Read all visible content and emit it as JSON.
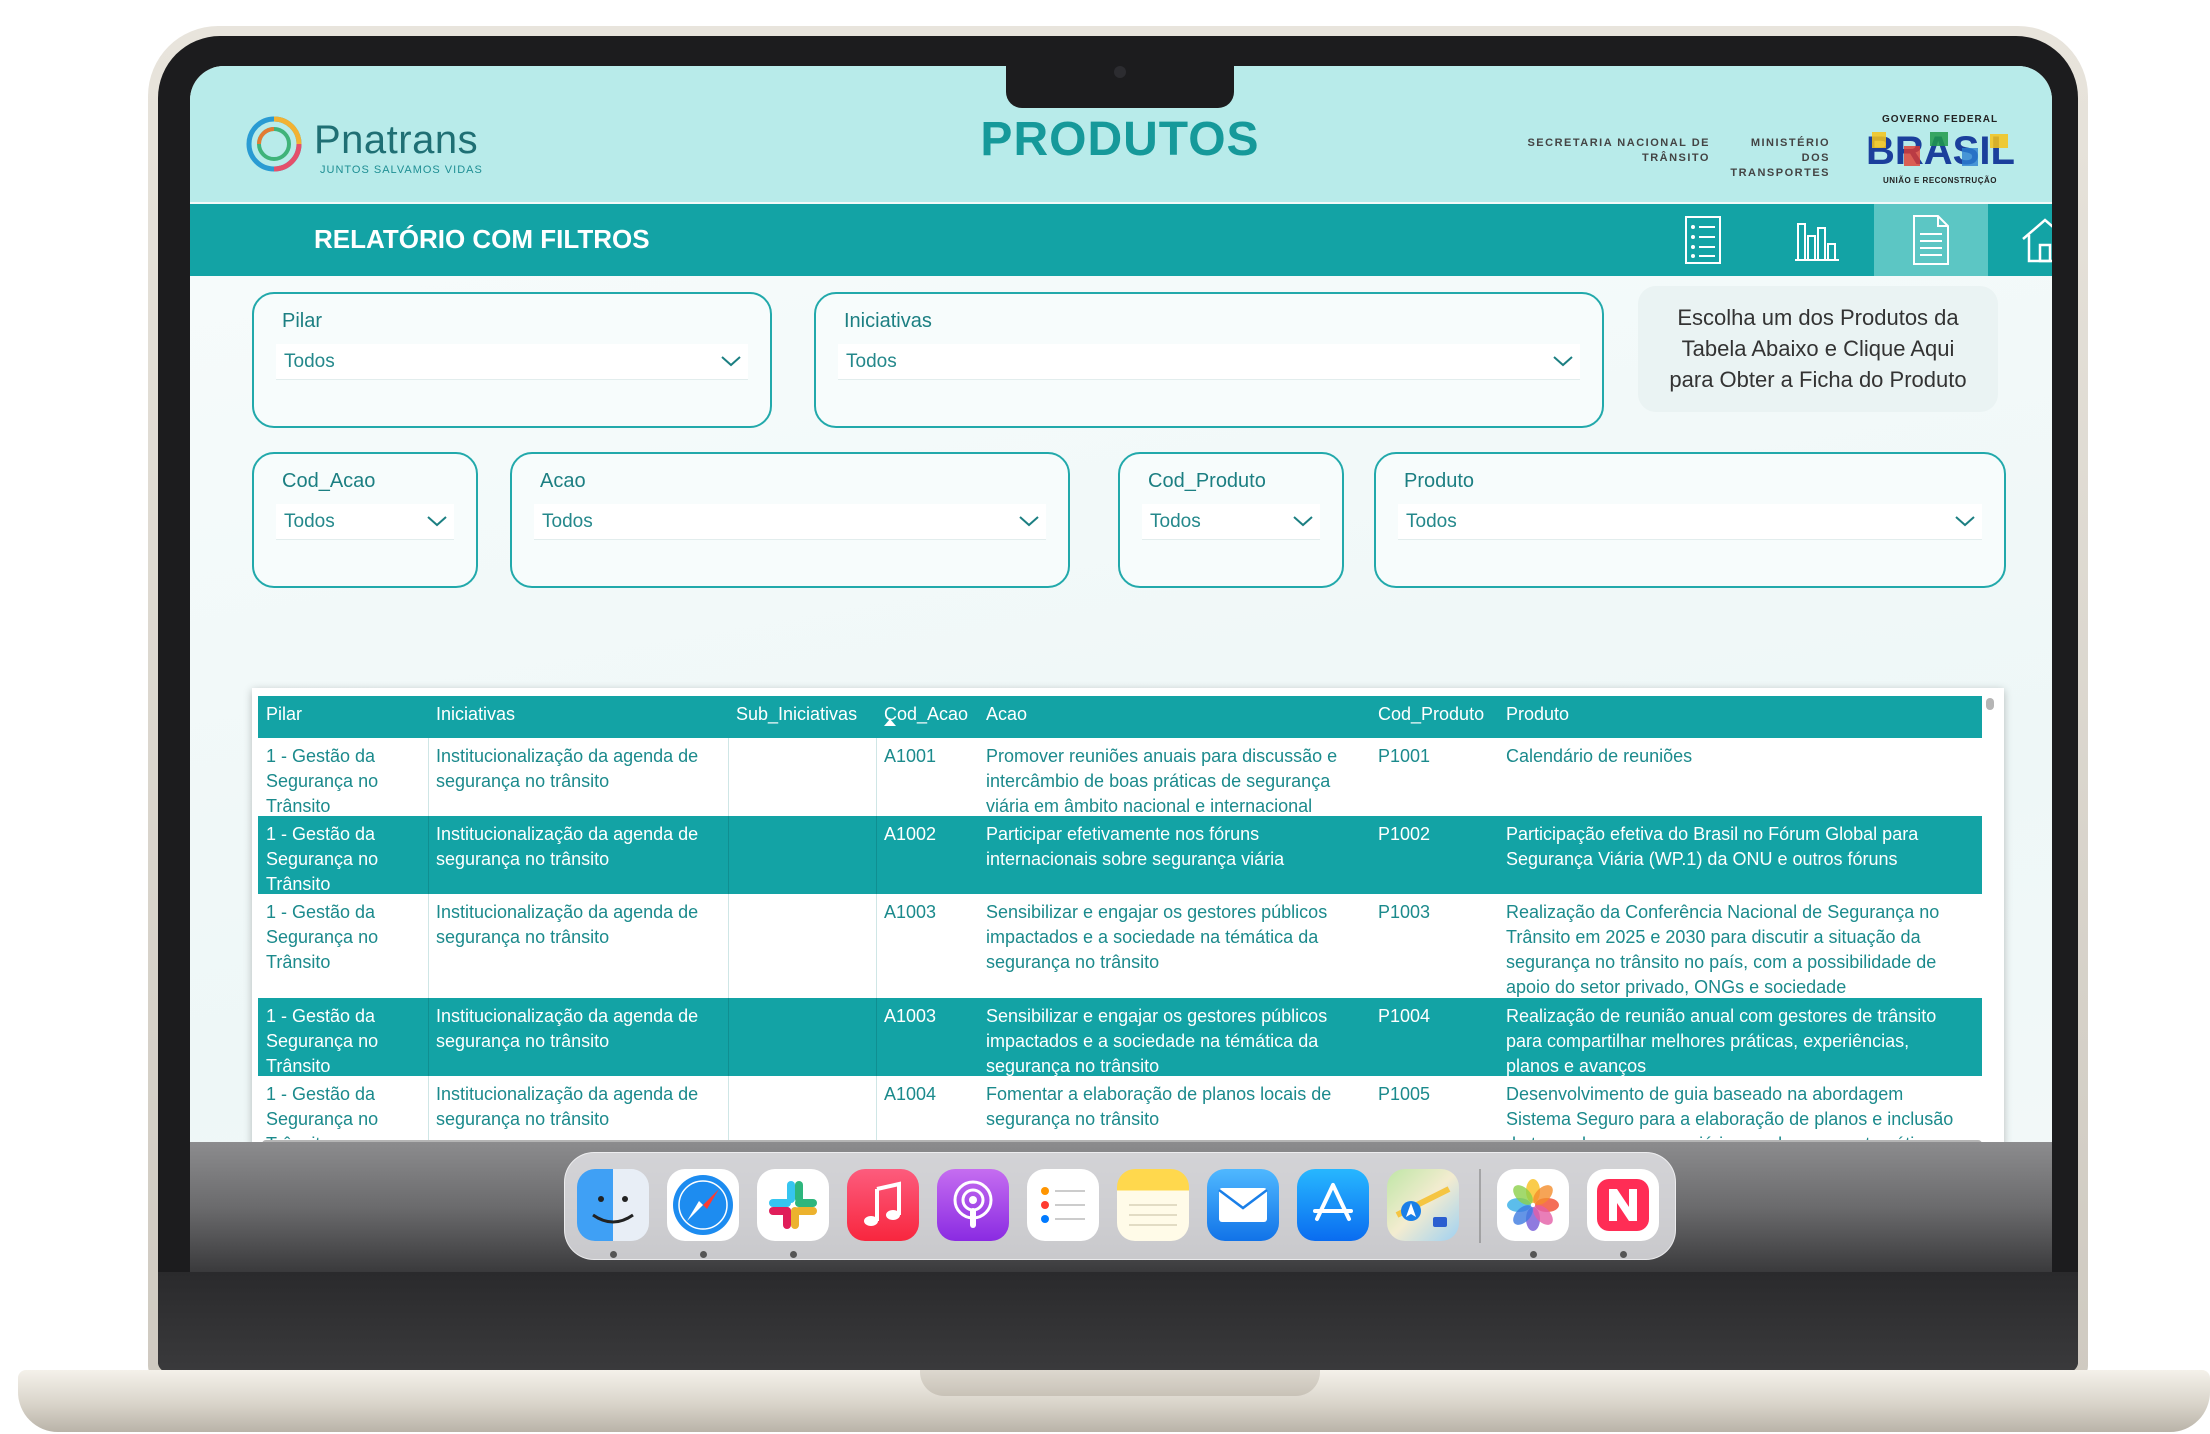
{
  "header": {
    "brand_name": "Pnatrans",
    "brand_tagline": "JUNTOS SALVAMOS VIDAS",
    "page_title": "PRODUTOS",
    "gov_secretaria_line1": "SECRETARIA NACIONAL DE",
    "gov_secretaria_line2": "TRÂNSITO",
    "gov_ministerio_line1": "MINISTÉRIO DOS",
    "gov_ministerio_line2": "TRANSPORTES",
    "govbr_top": "GOVERNO FEDERAL",
    "govbr_word": "BRASIL",
    "govbr_bottom": "UNIÃO E RECONSTRUÇÃO"
  },
  "nav": {
    "title": "RELATÓRIO COM FILTROS",
    "buttons": [
      {
        "icon": "list-icon"
      },
      {
        "icon": "bar-chart-icon"
      },
      {
        "icon": "document-icon",
        "active": true
      },
      {
        "icon": "home-icon"
      }
    ]
  },
  "filters": {
    "pilar": {
      "label": "Pilar",
      "value": "Todos"
    },
    "iniciativas": {
      "label": "Iniciativas",
      "value": "Todos"
    },
    "cod_acao": {
      "label": "Cod_Acao",
      "value": "Todos"
    },
    "acao": {
      "label": "Acao",
      "value": "Todos"
    },
    "cod_produto": {
      "label": "Cod_Produto",
      "value": "Todos"
    },
    "produto": {
      "label": "Produto",
      "value": "Todos"
    }
  },
  "hint": {
    "line1": "Escolha um dos Produtos da",
    "line2": "Tabela Abaixo e Clique Aqui",
    "line3": "para Obter a Ficha do Produto"
  },
  "table": {
    "columns": [
      "Pilar",
      "Iniciativas",
      "Sub_Iniciativas",
      "Cod_Acao",
      "Acao",
      "Cod_Produto",
      "Produto"
    ],
    "rows": [
      {
        "pilar": [
          "1 - Gestão da",
          "Segurança no",
          "Trânsito"
        ],
        "iniciativas": [
          "Institucionalização da agenda de",
          "segurança no trânsito"
        ],
        "sub": "",
        "cod_acao": "A1001",
        "acao": [
          "Promover reuniões anuais para discussão e",
          "intercâmbio de boas práticas de segurança",
          "viária em âmbito nacional e internacional"
        ],
        "cod_produto": "P1001",
        "produto": [
          "Calendário de reuniões"
        ]
      },
      {
        "pilar": [
          "1 - Gestão da",
          "Segurança no",
          "Trânsito"
        ],
        "iniciativas": [
          "Institucionalização da agenda de",
          "segurança no trânsito"
        ],
        "sub": "",
        "cod_acao": "A1002",
        "acao": [
          "Participar efetivamente nos fóruns",
          "internacionais sobre segurança viária"
        ],
        "cod_produto": "P1002",
        "produto": [
          "Participação efetiva do Brasil no Fórum Global para",
          "Segurança Viária (WP.1) da ONU e outros fóruns"
        ]
      },
      {
        "pilar": [
          "1 - Gestão da",
          "Segurança no",
          "Trânsito"
        ],
        "iniciativas": [
          "Institucionalização da agenda de",
          "segurança no trânsito"
        ],
        "sub": "",
        "cod_acao": "A1003",
        "acao": [
          "Sensibilizar e engajar os gestores públicos",
          "impactados e a sociedade na témática da",
          "segurança no trânsito"
        ],
        "cod_produto": "P1003",
        "produto": [
          "Realização da Conferência Nacional de Segurança no",
          "Trânsito em 2025 e 2030 para discutir a situação da",
          "segurança no trânsito no país, com a possibilidade de",
          "apoio do setor privado, ONGs e sociedade"
        ]
      },
      {
        "pilar": [
          "1 - Gestão da",
          "Segurança no",
          "Trânsito"
        ],
        "iniciativas": [
          "Institucionalização da agenda de",
          "segurança no trânsito"
        ],
        "sub": "",
        "cod_acao": "A1003",
        "acao": [
          "Sensibilizar e engajar os gestores públicos",
          "impactados e a sociedade na témática da",
          "segurança no trânsito"
        ],
        "cod_produto": "P1004",
        "produto": [
          "Realização de reunião anual com gestores de trânsito",
          "para compartilhar melhores práticas, experiências,",
          "planos e avanços"
        ]
      },
      {
        "pilar": [
          "1 - Gestão da",
          "Segurança no",
          "Trânsito"
        ],
        "iniciativas": [
          "Institucionalização da agenda de",
          "segurança no trânsito"
        ],
        "sub": "",
        "cod_acao": "A1004",
        "acao": [
          "Fomentar a elaboração de planos locais de",
          "segurança no trânsito"
        ],
        "cod_produto": "P1005",
        "produto": [
          "Desenvolvimento de guia baseado na abordagem",
          "Sistema Seguro para a elaboração de planos e inclusão",
          "do tema da segurança viária em planos com temática"
        ]
      }
    ]
  },
  "dock": {
    "apps": [
      "finder-icon",
      "safari-icon",
      "slack-icon",
      "music-icon",
      "podcasts-icon",
      "reminders-icon",
      "notes-icon",
      "mail-icon",
      "app-store-icon",
      "maps-icon",
      "photos-icon",
      "news-icon"
    ]
  },
  "colors": {
    "teal": "#13a3a5",
    "header_bg": "#b8ebea",
    "title_teal": "#16999a"
  }
}
